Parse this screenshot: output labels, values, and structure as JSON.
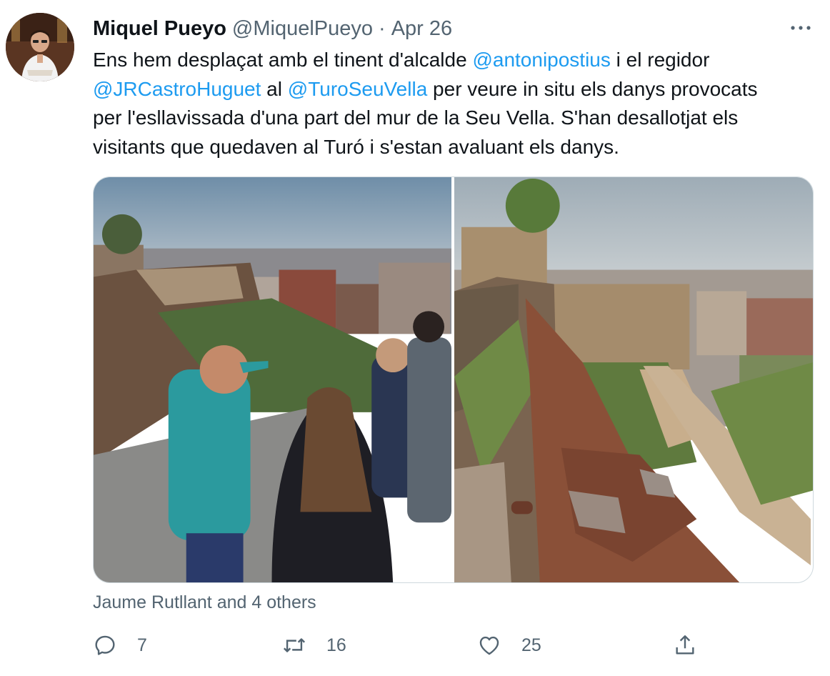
{
  "author": {
    "display_name": "Miquel Pueyo",
    "handle": "@MiquelPueyo",
    "separator": "·",
    "date": "Apr 26"
  },
  "tweet": {
    "lines": [
      {
        "t1": "Ens hem desplaçat amb el tinent d'alcalde ",
        "m1": "@antonipostius",
        "t2": " i el regidor"
      },
      {
        "m1": "@JRCastroHuguet",
        "t1": " al ",
        "m2": "@TuroSeuVella",
        "t2": " per veure in situ els danys provocats"
      },
      {
        "t1": "per  l'esllavissada d'una part del mur de la Seu Vella. S'han desallotjat els"
      },
      {
        "t1": "visitants que quedaven al Turó i s'estan avaluant els danys."
      }
    ]
  },
  "likers_text": "Jaume Rutllant and 4 others",
  "actions": {
    "reply": {
      "icon": "reply-icon",
      "count": "7"
    },
    "retweet": {
      "icon": "retweet-icon",
      "count": "16"
    },
    "like": {
      "icon": "heart-icon",
      "count": "25"
    },
    "share": {
      "icon": "share-icon"
    }
  },
  "more": {
    "icon": "more-icon"
  },
  "colors": {
    "link": "#1d9bf0",
    "secondary": "#536471",
    "text": "#0f1419"
  }
}
